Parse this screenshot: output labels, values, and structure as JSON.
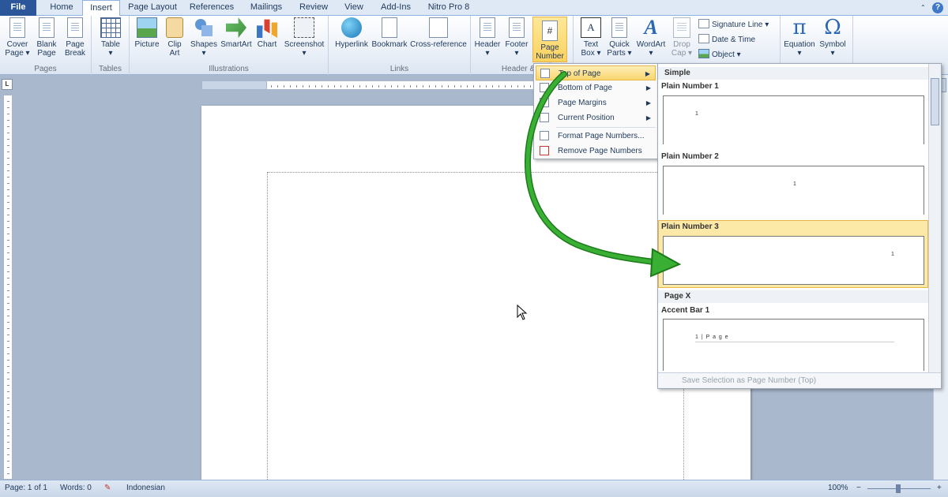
{
  "tabs": [
    {
      "label": "File"
    },
    {
      "label": "Home"
    },
    {
      "label": "Insert"
    },
    {
      "label": "Page Layout"
    },
    {
      "label": "References"
    },
    {
      "label": "Mailings"
    },
    {
      "label": "Review"
    },
    {
      "label": "View"
    },
    {
      "label": "Add-Ins"
    },
    {
      "label": "Nitro Pro 8"
    }
  ],
  "ribbon": {
    "groups": {
      "pages": "Pages",
      "tables": "Tables",
      "illustrations": "Illustrations",
      "links": "Links",
      "header_footer": "Header & F"
    },
    "buttons": {
      "cover_page_1": "Cover",
      "cover_page_2": "Page ▾",
      "blank_page_1": "Blank",
      "blank_page_2": "Page",
      "page_break_1": "Page",
      "page_break_2": "Break",
      "table_1": "Table",
      "table_2": "▾",
      "picture": "Picture",
      "clip_art_1": "Clip",
      "clip_art_2": "Art",
      "shapes_1": "Shapes",
      "shapes_2": "▾",
      "smartart": "SmartArt",
      "chart": "Chart",
      "screenshot_1": "Screenshot",
      "screenshot_2": "▾",
      "hyperlink": "Hyperlink",
      "bookmark": "Bookmark",
      "cross_reference": "Cross-reference",
      "header_1": "Header",
      "header_2": "▾",
      "footer_1": "Footer",
      "footer_2": "▾",
      "page_number_1": "Page",
      "page_number_2": "Number ▾",
      "text_box_1": "Text",
      "text_box_2": "Box ▾",
      "quick_parts_1": "Quick",
      "quick_parts_2": "Parts ▾",
      "wordart_1": "WordArt",
      "wordart_2": "▾",
      "drop_cap_1": "Drop",
      "drop_cap_2": "Cap ▾",
      "signature_line": "Signature Line ▾",
      "date_time": "Date & Time",
      "object": "Object ▾",
      "equation_1": "Equation",
      "equation_2": "▾",
      "symbol_1": "Symbol",
      "symbol_2": "▾"
    },
    "icons": {
      "equation": "π",
      "symbol": "Ω",
      "text_box": "A",
      "wordart": "A",
      "page_number": "#",
      "help": "?"
    }
  },
  "ruler_corner": "L",
  "page_number_menu": {
    "items": [
      {
        "label": "Top of Page",
        "submenu": true
      },
      {
        "label": "Bottom of Page",
        "submenu": true
      },
      {
        "label": "Page Margins",
        "submenu": true
      },
      {
        "label": "Current Position",
        "submenu": true
      },
      {
        "label": "Format Page Numbers...",
        "submenu": false
      },
      {
        "label": "Remove Page Numbers",
        "submenu": false
      }
    ],
    "arrow": "▶"
  },
  "gallery": {
    "category_simple": "Simple",
    "items": [
      {
        "name": "Plain Number 1",
        "preview": "1"
      },
      {
        "name": "Plain Number 2",
        "preview": "1"
      },
      {
        "name": "Plain Number 3",
        "preview": "1"
      }
    ],
    "category_page_x": "Page X",
    "accent_bar": {
      "name": "Accent Bar 1",
      "preview": "1 | P a g e"
    },
    "footer": "Save Selection as Page Number (Top)"
  },
  "status": {
    "page": "Page: 1 of 1",
    "words": "Words: 0",
    "language": "Indonesian",
    "zoom": "100%",
    "zoom_minus": "−",
    "zoom_plus": "+"
  },
  "colors": {
    "file_tab": "#2b579a",
    "highlight": "#fbd66f",
    "arrow": "#2e9e2a"
  }
}
